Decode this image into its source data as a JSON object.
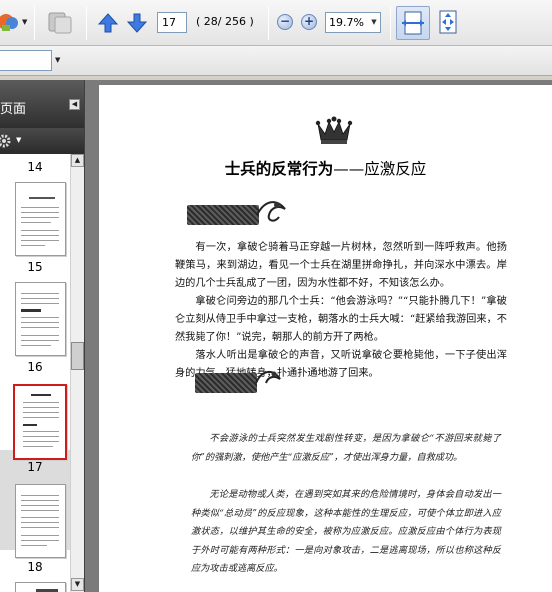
{
  "toolbar": {
    "page_number": "17",
    "page_total": "( 28/ 256 )",
    "zoom_value": "19.7%"
  },
  "sidebar": {
    "title": "页面",
    "thumbnails": [
      {
        "label": "14",
        "selected": false
      },
      {
        "label": "15",
        "selected": false
      },
      {
        "label": "16",
        "selected": false
      },
      {
        "label": "17",
        "selected": true
      },
      {
        "label": "18",
        "selected": false
      }
    ]
  },
  "document": {
    "chapter_title": "士兵的反常行为",
    "chapter_subtitle": "——应激反应",
    "section1_paragraphs": [
      "有一次，拿破仑骑着马正穿越一片树林，忽然听到一阵呼救声。他扬鞭策马，来到湖边，看见一个士兵在湖里拼命挣扎，并向深水中漂去。岸边的几个士兵乱成了一团，因为水性都不好，不知该怎么办。",
      "拿破仑问旁边的那几个士兵：“他会游泳吗？”“只能扑腾几下！”拿破仑立刻从侍卫手中拿过一支枪，朝落水的士兵大喊：“赶紧给我游回来，不然我毙了你！”说完，朝那人的前方开了两枪。",
      "落水人听出是拿破仑的声音，又听说拿破仑要枪毙他，一下子使出浑身的力气，猛地转身，扑通扑通地游了回来。"
    ],
    "section2_paragraphs": [
      "不会游泳的士兵突然发生戏剧性转变，是因为拿破仑“不游回来就毙了你”的强刺激，使他产生“应激反应”，才使出浑身力量，自救成功。",
      "无论是动物或人类，在遇到突如其来的危险情境时，身体会自动发出一种类似“总动员”的反应现象，这种本能性的生理反应，可使个体立即进入应激状态，以维护其生命的安全，被称为应激反应。应激反应由个体行为表现于外时可能有两种形式：一是向对象攻击，二是逃离现场，所以也称这种反应为攻击或逃离反应。"
    ]
  }
}
